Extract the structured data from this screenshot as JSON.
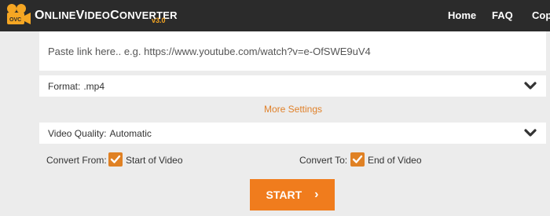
{
  "header": {
    "logo_text_first": "O",
    "logo_text_mid": "NLINE",
    "logo_text_v": "V",
    "logo_text_ideo": "IDEO",
    "logo_text_c": "C",
    "logo_text_onverter": "ONVERTER",
    "version": "v3.0",
    "logo_badge": "OVC",
    "nav": [
      {
        "label": "Home"
      },
      {
        "label": "FAQ"
      },
      {
        "label": "Copy"
      }
    ]
  },
  "converter": {
    "url_placeholder": "Paste link here.. e.g. https://www.youtube.com/watch?v=e-OfSWE9uV4",
    "format_label": "Format:",
    "format_value": ".mp4",
    "more_settings": "More Settings",
    "quality_label": "Video Quality:",
    "quality_value": "Automatic",
    "convert_from_label": "Convert From:",
    "convert_from_option": "Start of Video",
    "convert_from_checked": true,
    "convert_to_label": "Convert To:",
    "convert_to_option": "End of Video",
    "convert_to_checked": true,
    "start_label": "START",
    "start_arrow": "›"
  },
  "colors": {
    "accent": "#f07c1d",
    "navbar": "#2b2b2b",
    "background": "#ececec"
  }
}
